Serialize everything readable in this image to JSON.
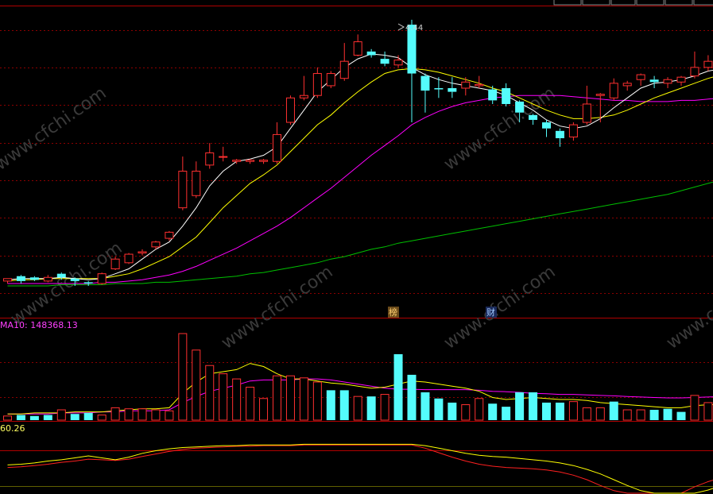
{
  "toolbar": {
    "left_fragment": "",
    "buttons": [
      "",
      "",
      "",
      "",
      "",
      ""
    ]
  },
  "price_panel": {
    "high_marker": "4.44",
    "tags": [
      "榜",
      "财"
    ]
  },
  "volume_panel": {
    "ma_label": "MA10: 148368.13"
  },
  "indicator_panel": {
    "label": "60.26"
  },
  "colors": {
    "up": "#ff3030",
    "down": "#54fcfc",
    "ma_white": "#ffffff",
    "ma_yellow": "#ffff00",
    "ma_magenta": "#ff00ff",
    "ma_green": "#00c000",
    "grid": "#8b0000",
    "frame": "#b00000"
  },
  "chart_data": {
    "type": "candlestick",
    "price": {
      "ylim": [
        2.0,
        4.55
      ],
      "candles": [
        [
          2.3,
          2.32,
          2.28,
          2.31
        ],
        [
          2.34,
          2.3,
          2.28,
          2.35
        ],
        [
          2.33,
          2.31,
          2.3,
          2.34
        ],
        [
          2.3,
          2.33,
          2.29,
          2.35
        ],
        [
          2.36,
          2.33,
          2.31,
          2.37
        ],
        [
          2.32,
          2.3,
          2.26,
          2.33
        ],
        [
          2.29,
          2.28,
          2.26,
          2.3
        ],
        [
          2.28,
          2.36,
          2.27,
          2.37
        ],
        [
          2.4,
          2.48,
          2.39,
          2.5
        ],
        [
          2.45,
          2.52,
          2.44,
          2.53
        ],
        [
          2.53,
          2.54,
          2.51,
          2.56
        ],
        [
          2.58,
          2.62,
          2.56,
          2.63
        ],
        [
          2.65,
          2.7,
          2.63,
          2.71
        ],
        [
          2.9,
          3.2,
          2.88,
          3.32
        ],
        [
          3.0,
          3.2,
          2.98,
          3.28
        ],
        [
          3.25,
          3.35,
          3.22,
          3.43
        ],
        [
          3.32,
          3.32,
          3.28,
          3.4
        ],
        [
          3.28,
          3.29,
          3.26,
          3.3
        ],
        [
          3.28,
          3.29,
          3.26,
          3.3
        ],
        [
          3.28,
          3.29,
          3.26,
          3.3
        ],
        [
          3.28,
          3.5,
          3.26,
          3.6
        ],
        [
          3.6,
          3.8,
          3.58,
          3.82
        ],
        [
          3.8,
          3.82,
          3.78,
          3.98
        ],
        [
          3.82,
          4.0,
          3.8,
          4.05
        ],
        [
          3.9,
          4.0,
          3.88,
          4.02
        ],
        [
          3.96,
          4.1,
          3.94,
          4.25
        ],
        [
          4.15,
          4.26,
          4.14,
          4.32
        ],
        [
          4.18,
          4.15,
          4.13,
          4.2
        ],
        [
          4.12,
          4.08,
          4.06,
          4.18
        ],
        [
          4.07,
          4.11,
          4.05,
          4.15
        ],
        [
          4.4,
          4.0,
          3.6,
          4.44
        ],
        [
          3.98,
          3.86,
          3.68,
          4.0
        ],
        [
          3.88,
          3.87,
          3.8,
          3.97
        ],
        [
          3.88,
          3.85,
          3.8,
          3.97
        ],
        [
          3.88,
          3.93,
          3.82,
          3.97
        ],
        [
          3.9,
          3.91,
          3.88,
          3.98
        ],
        [
          3.87,
          3.78,
          3.75,
          3.9
        ],
        [
          3.88,
          3.75,
          3.73,
          3.92
        ],
        [
          3.77,
          3.68,
          3.6,
          3.78
        ],
        [
          3.66,
          3.62,
          3.58,
          3.67
        ],
        [
          3.6,
          3.55,
          3.48,
          3.62
        ],
        [
          3.53,
          3.47,
          3.4,
          3.55
        ],
        [
          3.48,
          3.58,
          3.45,
          3.6
        ],
        [
          3.6,
          3.75,
          3.58,
          3.9
        ],
        [
          3.82,
          3.83,
          3.6,
          3.84
        ],
        [
          3.8,
          3.92,
          3.78,
          3.96
        ],
        [
          3.9,
          3.92,
          3.86,
          3.94
        ],
        [
          3.95,
          3.99,
          3.9,
          4.0
        ],
        [
          3.95,
          3.93,
          3.88,
          3.98
        ],
        [
          3.92,
          3.95,
          3.88,
          3.97
        ],
        [
          3.93,
          3.97,
          3.9,
          3.98
        ],
        [
          3.98,
          4.05,
          3.96,
          4.18
        ],
        [
          4.05,
          4.1,
          4.02,
          4.15
        ],
        [
          4.08,
          4.05,
          4.0,
          4.22
        ]
      ],
      "ma5": [
        2.31,
        2.32,
        2.32,
        2.32,
        2.33,
        2.32,
        2.31,
        2.32,
        2.36,
        2.4,
        2.48,
        2.56,
        2.62,
        2.75,
        2.9,
        3.08,
        3.2,
        3.28,
        3.3,
        3.33,
        3.4,
        3.55,
        3.7,
        3.85,
        3.95,
        4.05,
        4.12,
        4.16,
        4.15,
        4.13,
        4.05,
        3.99,
        3.95,
        3.92,
        3.9,
        3.88,
        3.86,
        3.82,
        3.76,
        3.7,
        3.62,
        3.57,
        3.55,
        3.57,
        3.63,
        3.72,
        3.8,
        3.88,
        3.92,
        3.93,
        3.95,
        3.98,
        4.02,
        4.04
      ],
      "ma10": [
        2.3,
        2.31,
        2.31,
        2.32,
        2.32,
        2.32,
        2.32,
        2.32,
        2.34,
        2.36,
        2.4,
        2.45,
        2.5,
        2.58,
        2.66,
        2.78,
        2.9,
        3.0,
        3.1,
        3.17,
        3.25,
        3.36,
        3.47,
        3.58,
        3.66,
        3.76,
        3.85,
        3.93,
        4.0,
        4.03,
        4.04,
        4.03,
        4.01,
        3.98,
        3.95,
        3.92,
        3.88,
        3.85,
        3.8,
        3.75,
        3.7,
        3.66,
        3.63,
        3.63,
        3.64,
        3.66,
        3.7,
        3.75,
        3.8,
        3.84,
        3.88,
        3.92,
        3.96,
        3.99
      ],
      "ma20": [
        2.28,
        2.28,
        2.28,
        2.28,
        2.28,
        2.28,
        2.28,
        2.29,
        2.29,
        2.3,
        2.31,
        2.33,
        2.35,
        2.38,
        2.42,
        2.47,
        2.52,
        2.57,
        2.63,
        2.69,
        2.75,
        2.82,
        2.9,
        2.98,
        3.06,
        3.15,
        3.24,
        3.33,
        3.41,
        3.49,
        3.58,
        3.64,
        3.69,
        3.73,
        3.76,
        3.78,
        3.8,
        3.81,
        3.82,
        3.82,
        3.82,
        3.82,
        3.81,
        3.8,
        3.79,
        3.78,
        3.78,
        3.77,
        3.77,
        3.77,
        3.78,
        3.78,
        3.79,
        3.8
      ],
      "ma60": [
        2.26,
        2.26,
        2.26,
        2.26,
        2.27,
        2.27,
        2.27,
        2.27,
        2.28,
        2.28,
        2.28,
        2.29,
        2.29,
        2.3,
        2.31,
        2.32,
        2.33,
        2.34,
        2.36,
        2.37,
        2.39,
        2.41,
        2.43,
        2.45,
        2.48,
        2.5,
        2.53,
        2.56,
        2.58,
        2.61,
        2.63,
        2.65,
        2.67,
        2.69,
        2.71,
        2.73,
        2.75,
        2.77,
        2.79,
        2.81,
        2.83,
        2.85,
        2.87,
        2.89,
        2.91,
        2.93,
        2.95,
        2.97,
        2.99,
        3.01,
        3.04,
        3.07,
        3.1,
        3.13
      ]
    },
    "volume": {
      "ylim": [
        0,
        420000
      ],
      "values": [
        20000,
        25000,
        20000,
        25000,
        50000,
        30000,
        35000,
        25000,
        60000,
        55000,
        55000,
        50000,
        45000,
        420000,
        340000,
        265000,
        225000,
        200000,
        160000,
        105000,
        215000,
        215000,
        205000,
        185000,
        145000,
        145000,
        115000,
        115000,
        125000,
        320000,
        220000,
        135000,
        105000,
        85000,
        75000,
        105000,
        80000,
        65000,
        135000,
        135000,
        85000,
        85000,
        90000,
        60000,
        60000,
        90000,
        50000,
        50000,
        50000,
        55000,
        40000,
        120000,
        85000,
        70000
      ],
      "up": [
        1,
        0,
        0,
        0,
        1,
        0,
        0,
        1,
        1,
        1,
        1,
        1,
        1,
        1,
        1,
        1,
        1,
        1,
        1,
        1,
        1,
        1,
        1,
        1,
        0,
        0,
        1,
        0,
        1,
        0,
        0,
        0,
        0,
        0,
        1,
        1,
        0,
        0,
        0,
        0,
        0,
        0,
        1,
        1,
        1,
        0,
        1,
        1,
        0,
        0,
        0,
        1,
        1,
        0
      ],
      "ma5": [
        30000,
        30000,
        35000,
        35000,
        35000,
        40000,
        40000,
        40000,
        45000,
        50000,
        55000,
        55000,
        60000,
        130000,
        185000,
        225000,
        235000,
        245000,
        275000,
        260000,
        225000,
        200000,
        200000,
        190000,
        180000,
        175000,
        165000,
        155000,
        160000,
        175000,
        190000,
        185000,
        175000,
        165000,
        155000,
        140000,
        110000,
        100000,
        105000,
        110000,
        105000,
        100000,
        100000,
        95000,
        85000,
        80000,
        75000,
        70000,
        65000,
        60000,
        60000,
        70000,
        75000,
        75000
      ],
      "ma10": [
        30000,
        30000,
        30000,
        30000,
        35000,
        35000,
        35000,
        40000,
        40000,
        45000,
        45000,
        45000,
        50000,
        85000,
        115000,
        140000,
        155000,
        170000,
        190000,
        195000,
        195000,
        195000,
        200000,
        200000,
        195000,
        185000,
        175000,
        165000,
        155000,
        150000,
        150000,
        148000,
        148000,
        148000,
        148000,
        145000,
        140000,
        138000,
        135000,
        130000,
        128000,
        125000,
        125000,
        122000,
        120000,
        118000,
        115000,
        112000,
        110000,
        108000,
        108000,
        110000,
        112000,
        115000
      ]
    },
    "indicator": {
      "ylim": [
        0,
        100
      ],
      "yellow": [
        44,
        45,
        47,
        50,
        52,
        55,
        58,
        55,
        52,
        56,
        62,
        66,
        69,
        71,
        72,
        73,
        74,
        74,
        75,
        75,
        75,
        75,
        76,
        76,
        76,
        76,
        76,
        76,
        76,
        76,
        76,
        74,
        70,
        66,
        62,
        59,
        57,
        56,
        54,
        52,
        50,
        47,
        43,
        37,
        30,
        21,
        12,
        4,
        0,
        0,
        0,
        0,
        5,
        12
      ],
      "red": [
        40,
        41,
        43,
        45,
        48,
        50,
        53,
        52,
        51,
        53,
        57,
        61,
        65,
        68,
        70,
        71,
        72,
        73,
        73,
        74,
        74,
        74,
        75,
        75,
        75,
        75,
        75,
        75,
        75,
        75,
        75,
        70,
        63,
        56,
        50,
        45,
        42,
        40,
        39,
        38,
        36,
        33,
        28,
        21,
        12,
        4,
        0,
        0,
        0,
        0,
        0,
        10,
        18,
        24
      ]
    }
  }
}
